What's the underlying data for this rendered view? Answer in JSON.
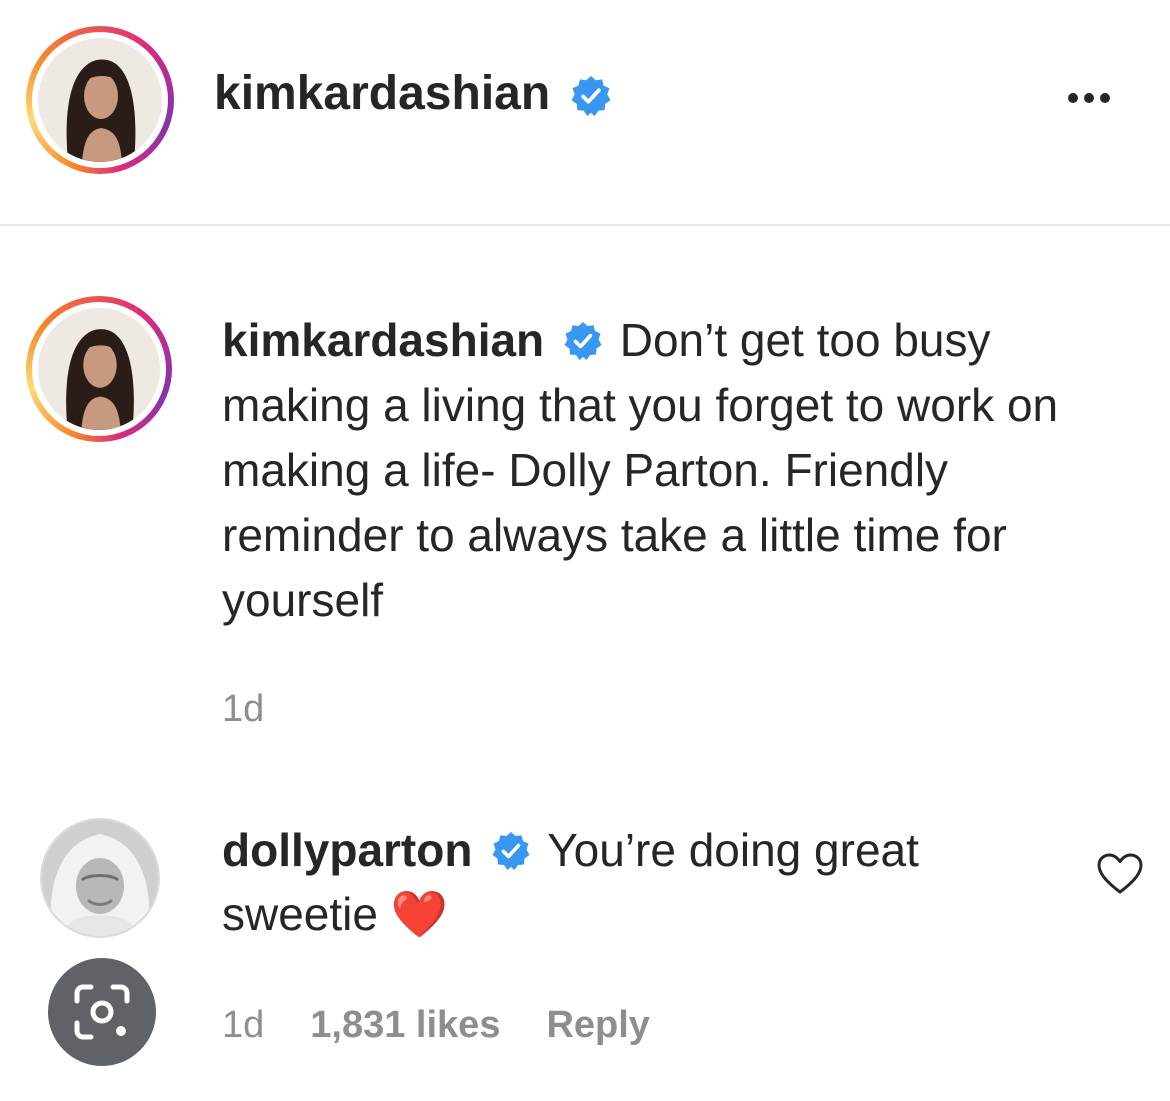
{
  "post": {
    "username": "kimkardashian",
    "verified_icon": "verified-badge-icon",
    "more_icon": "more-options-icon"
  },
  "caption": {
    "username": "kimkardashian",
    "text": "Don’t get too busy making a living that you forget to work on making a life- Dolly Parton. Friendly reminder to always take a little time for yourself",
    "time": "1d"
  },
  "comment": {
    "username": "dollyparton",
    "text": "You’re doing great sweetie",
    "emoji": "❤️",
    "time": "1d",
    "likes": "1,831 likes",
    "reply_label": "Reply",
    "like_icon": "heart-outline-icon"
  },
  "overlay": {
    "icon": "google-lens-icon"
  },
  "colors": {
    "verified": "#3897f0",
    "secondary_text": "#8e8e8e",
    "primary_text": "#262626"
  }
}
